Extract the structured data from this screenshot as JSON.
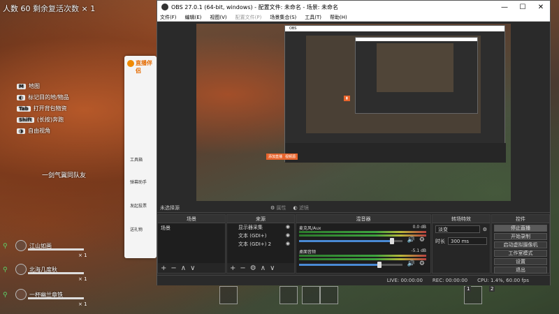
{
  "game": {
    "hud_top_a": "人数 60",
    "hud_top_b": "剩余复活次数",
    "hud_top_c": "× 1",
    "hints": [
      {
        "key": "M",
        "text": "地图"
      },
      {
        "key": "",
        "text": "标记目的地/物品"
      },
      {
        "key": "Tab",
        "text": "打开背包物资"
      },
      {
        "key": "Shift",
        "text": "(长按)奔跑"
      },
      {
        "key": "",
        "text": "自由视角"
      }
    ],
    "team_line": "一剑气冀同队友",
    "players": [
      {
        "name": "江山如画",
        "count": "× 1"
      },
      {
        "name": "北海几度秋",
        "count": "× 1"
      },
      {
        "name": "一杯幽兰章铁",
        "count": "× 1"
      }
    ],
    "hotbar_nums": [
      "1",
      "2"
    ]
  },
  "bgapp": {
    "title": "直播伴侣",
    "items": [
      "工具箱",
      "弹幕助手",
      "发起投票",
      "送礼物"
    ]
  },
  "obs": {
    "title": "OBS 27.0.1 (64-bit, windows) - 配置文件: 未命名 - 场景: 未命名",
    "window_controls": {
      "minimize": "—",
      "maximize": "☐",
      "close": "✕"
    },
    "menu": [
      "文件(F)",
      "编辑(E)",
      "视图(V)",
      "配置文件(P)",
      "场景集合(S)",
      "工具(T)",
      "帮助(H)"
    ],
    "preview_tags": [
      "添加直播",
      "视频源"
    ],
    "no_source_selected": "未选择源",
    "properties_label": "属性",
    "filters_label": "滤镜",
    "docks": {
      "scenes": {
        "title": "场景",
        "items": [
          "场景"
        ]
      },
      "sources": {
        "title": "来源",
        "items": [
          "显示器采集",
          "文本 (GDI+)",
          "文本 (GDI+) 2"
        ]
      },
      "mixer": {
        "title": "混音器",
        "channels": [
          {
            "name": "麦克风/Aux",
            "db": "0.0 dB",
            "level": 0.9
          },
          {
            "name": "桌面音频",
            "db": "-5.1 dB",
            "level": 0.78
          }
        ]
      },
      "transitions": {
        "title": "转场特效",
        "type": "淡变",
        "duration_label": "时长",
        "duration": "300 ms"
      },
      "controls": {
        "title": "控件",
        "buttons": [
          "停止直播",
          "开始录制",
          "启动虚拟摄像机",
          "工作室模式",
          "设置",
          "退出"
        ]
      }
    },
    "status": {
      "live": "LIVE: 00:00:00",
      "rec": "REC: 00:00:00",
      "cpu": "CPU: 1.4%, 60.00 fps"
    }
  },
  "colors": {
    "accent_orange": "#e8642c",
    "obs_bg": "#2a2a2a",
    "meter_green": "#3ea33e",
    "slider_blue": "#4a8ad4"
  }
}
